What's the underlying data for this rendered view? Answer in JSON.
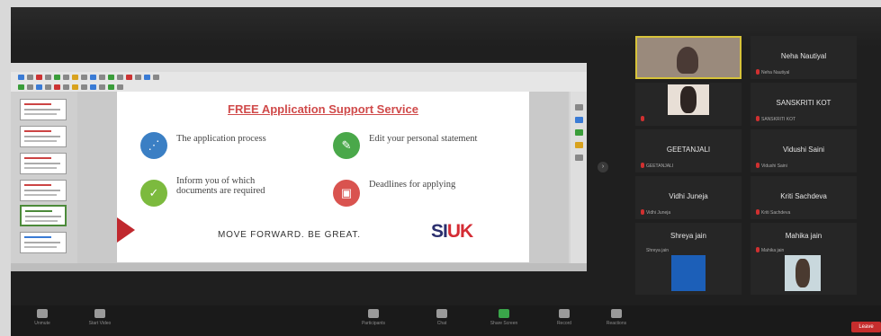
{
  "slide": {
    "title": "FREE Application Support Service",
    "features": [
      {
        "text": "The application process",
        "icon": "process-icon",
        "color": "#3b7fc4"
      },
      {
        "text": "Edit your personal statement",
        "icon": "pencil-icon",
        "color": "#4aa84a"
      },
      {
        "text": "Inform you of which documents are required",
        "icon": "check-icon",
        "color": "#7cba3e"
      },
      {
        "text": "Deadlines for applying",
        "icon": "calendar-icon",
        "color": "#d9534f"
      }
    ],
    "tagline": "MOVE FORWARD. BE GREAT.",
    "logo_left": "SI",
    "logo_right": "UK"
  },
  "participants": [
    {
      "name": "",
      "sub": "",
      "video": true
    },
    {
      "name": "Neha Nautiyal",
      "sub": "Neha Nautiyal"
    },
    {
      "name": "",
      "sub": "",
      "video": true
    },
    {
      "name": "SANSKRITI KOT",
      "sub": "SANSKRITI KOT"
    },
    {
      "name": "GEETANJALI",
      "sub": "GEETANJALI"
    },
    {
      "name": "Vidushi Saini",
      "sub": "Vidushi Saini"
    },
    {
      "name": "Vidhi Juneja",
      "sub": "Vidhi Juneja"
    },
    {
      "name": "Kriti Sachdeva",
      "sub": "Kriti Sachdeva"
    },
    {
      "name": "Shreya jain",
      "sub": "Shreya jain"
    },
    {
      "name": "Mahika jain",
      "sub": "Mahika jain"
    },
    {
      "name": "",
      "sub": "",
      "video": true
    },
    {
      "name": "",
      "sub": "",
      "video": true
    }
  ],
  "controls": {
    "unmute": "Unmute",
    "start_video": "Start Video",
    "participants": "Participants",
    "chat": "Chat",
    "share_screen": "Share Screen",
    "record": "Record",
    "reactions": "Reactions",
    "end": "Leave"
  }
}
